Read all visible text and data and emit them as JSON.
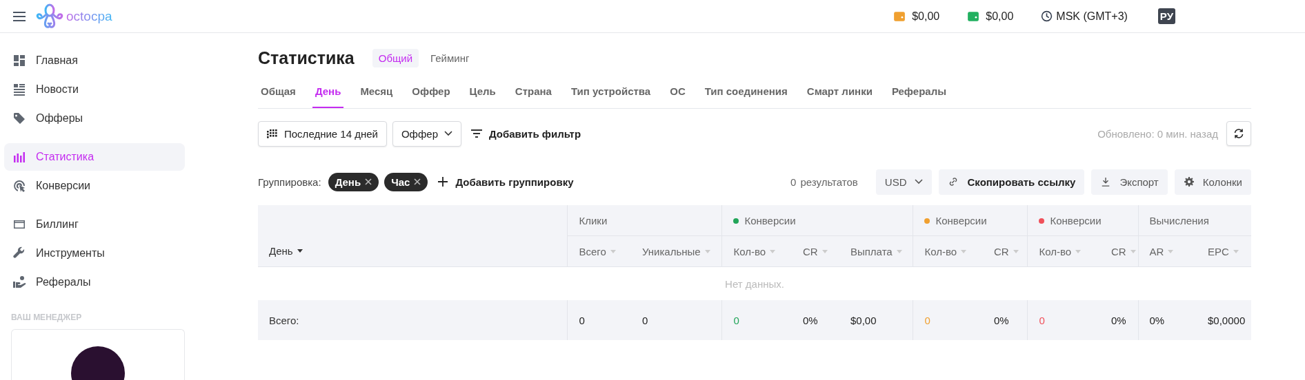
{
  "header": {
    "logo_text": "octocpa",
    "balances": [
      {
        "amount": "$0,00",
        "color": "#f0a030"
      },
      {
        "amount": "$0,00",
        "color": "#22b060"
      }
    ],
    "timezone": "MSK (GMT+3)",
    "language": "РУ"
  },
  "sidebar": {
    "sections": [
      {
        "items": [
          {
            "label": "Главная",
            "selected": false
          },
          {
            "label": "Новости",
            "selected": false
          },
          {
            "label": "Офферы",
            "selected": false
          }
        ]
      },
      {
        "items": [
          {
            "label": "Статистика",
            "selected": true
          },
          {
            "label": "Конверсии",
            "selected": false
          }
        ]
      },
      {
        "items": [
          {
            "label": "Биллинг",
            "selected": false
          },
          {
            "label": "Инструменты",
            "selected": false
          },
          {
            "label": "Рефералы",
            "selected": false
          }
        ]
      }
    ],
    "manager_title": "ВАШ МЕНЕДЖЕР"
  },
  "page": {
    "title": "Статистика",
    "segments": [
      {
        "label": "Общий",
        "selected": true
      },
      {
        "label": "Гейминг",
        "selected": false
      }
    ],
    "tabs": [
      {
        "label": "Общая",
        "selected": false
      },
      {
        "label": "День",
        "selected": true
      },
      {
        "label": "Месяц",
        "selected": false
      },
      {
        "label": "Оффер",
        "selected": false
      },
      {
        "label": "Цель",
        "selected": false
      },
      {
        "label": "Страна",
        "selected": false
      },
      {
        "label": "Тип устройства",
        "selected": false
      },
      {
        "label": "ОС",
        "selected": false
      },
      {
        "label": "Тип соединения",
        "selected": false
      },
      {
        "label": "Смарт линки",
        "selected": false
      },
      {
        "label": "Рефералы",
        "selected": false
      }
    ],
    "filters": {
      "date_range": "Последние 14 дней",
      "offer_select": "Оффер",
      "add_filter": "Добавить фильтр",
      "updated": "Обновлено: 0 мин. назад"
    },
    "grouping": {
      "label": "Группировка:",
      "chips": [
        "День",
        "Час"
      ],
      "add": "Добавить группировку",
      "results_count": "0",
      "results_label": "результатов",
      "currency": "USD",
      "copy_link": "Скопировать ссылку",
      "export": "Экспорт",
      "columns": "Колонки"
    }
  },
  "table": {
    "first_column": "День",
    "groups": [
      {
        "label": "Клики",
        "columns": [
          "Всего",
          "Уникальные"
        ]
      },
      {
        "label": "Конверсии",
        "color": "#22a559",
        "columns": [
          "Кол-во",
          "CR",
          "Выплата"
        ]
      },
      {
        "label": "Конверсии",
        "color": "#f0a030",
        "columns": [
          "Кол-во",
          "CR"
        ]
      },
      {
        "label": "Конверсии",
        "color": "#f0505a",
        "columns": [
          "Кол-во",
          "CR"
        ]
      },
      {
        "label": "Вычисления",
        "columns": [
          "AR",
          "EPC"
        ]
      }
    ],
    "empty_text": "Нет данных.",
    "total": {
      "label": "Всего:",
      "cells": [
        {
          "value": "0"
        },
        {
          "value": "0"
        },
        {
          "value": "0",
          "color": "#22a559"
        },
        {
          "value": "0%"
        },
        {
          "value": "$0,00"
        },
        {
          "value": "0",
          "color": "#f0a030"
        },
        {
          "value": "0%"
        },
        {
          "value": "0",
          "color": "#f0505a"
        },
        {
          "value": "0%"
        },
        {
          "value": "0%"
        },
        {
          "value": "$0,0000"
        }
      ]
    }
  }
}
